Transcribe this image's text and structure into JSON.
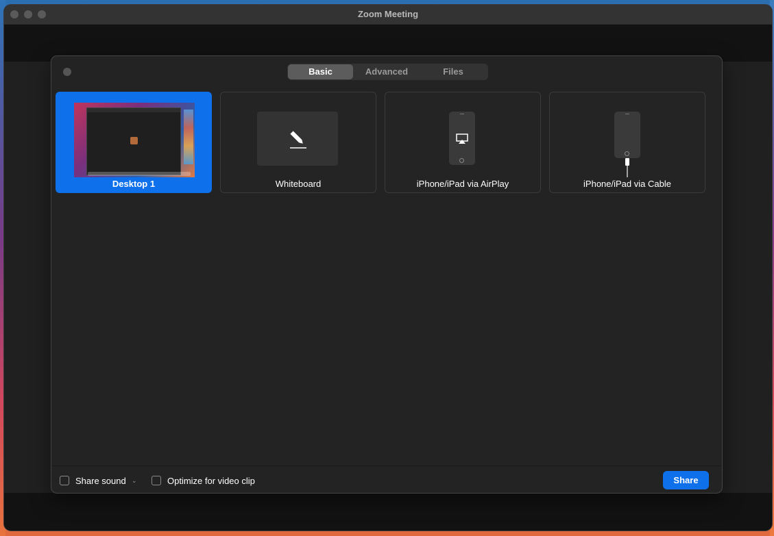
{
  "window": {
    "title": "Zoom Meeting"
  },
  "tabs": [
    {
      "label": "Basic",
      "active": true
    },
    {
      "label": "Advanced",
      "active": false
    },
    {
      "label": "Files",
      "active": false
    }
  ],
  "cards": [
    {
      "label": "Desktop 1",
      "selected": true,
      "icon": "desktop-thumbnail"
    },
    {
      "label": "Whiteboard",
      "selected": false,
      "icon": "pencil-icon"
    },
    {
      "label": "iPhone/iPad via AirPlay",
      "selected": false,
      "icon": "airplay-icon"
    },
    {
      "label": "iPhone/iPad via Cable",
      "selected": false,
      "icon": "cable-icon"
    }
  ],
  "footer": {
    "share_sound_label": "Share sound",
    "share_sound_checked": false,
    "optimize_label": "Optimize for video clip",
    "optimize_checked": false,
    "share_button": "Share"
  },
  "colors": {
    "accent": "#0e71eb",
    "dialog_bg": "#232323"
  }
}
